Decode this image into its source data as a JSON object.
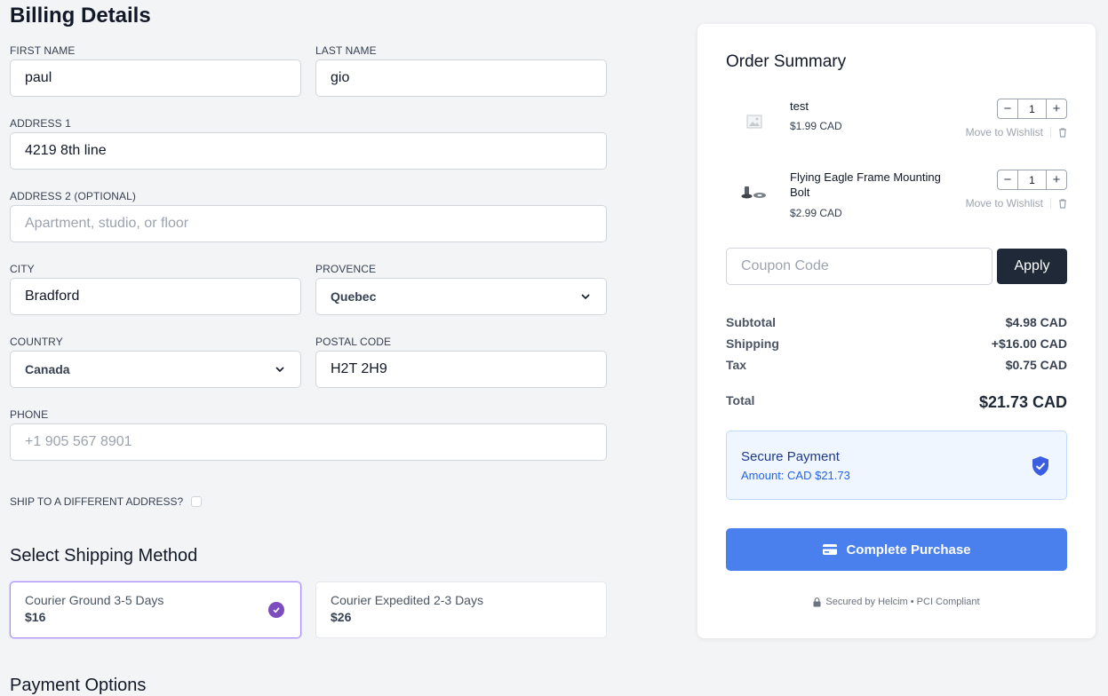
{
  "billing": {
    "title": "Billing Details",
    "first_name": {
      "label": "FIRST NAME",
      "value": "paul"
    },
    "last_name": {
      "label": "LAST NAME",
      "value": "gio"
    },
    "address1": {
      "label": "ADDRESS 1",
      "value": "4219 8th line"
    },
    "address2": {
      "label": "ADDRESS 2 (OPTIONAL)",
      "placeholder": "Apartment, studio, or floor"
    },
    "city": {
      "label": "CITY",
      "value": "Bradford"
    },
    "province": {
      "label": "PROVENCE",
      "value": "Quebec"
    },
    "country": {
      "label": "COUNTRY",
      "value": "Canada"
    },
    "postal": {
      "label": "POSTAL CODE",
      "value": "H2T 2H9"
    },
    "phone": {
      "label": "PHONE",
      "placeholder": "+1 905 567 8901"
    },
    "ship_different": "SHIP TO A DIFFERENT ADDRESS?"
  },
  "shipping": {
    "title": "Select Shipping Method",
    "options": [
      {
        "name": "Courier Ground 3-5 Days",
        "price": "$16",
        "selected": true
      },
      {
        "name": "Courier Expedited 2-3 Days",
        "price": "$26",
        "selected": false
      }
    ]
  },
  "payment_options_title": "Payment Options",
  "summary": {
    "title": "Order Summary",
    "items": [
      {
        "name": "test",
        "price": "$1.99 CAD",
        "qty": "1",
        "wishlist": "Move to Wishlist"
      },
      {
        "name": "Flying Eagle Frame Mounting Bolt",
        "price": "$2.99 CAD",
        "qty": "1",
        "wishlist": "Move to Wishlist"
      }
    ],
    "coupon_placeholder": "Coupon Code",
    "apply_label": "Apply",
    "subtotal": {
      "label": "Subtotal",
      "value": "$4.98 CAD"
    },
    "shipping": {
      "label": "Shipping",
      "value": "+$16.00 CAD"
    },
    "tax": {
      "label": "Tax",
      "value": "$0.75 CAD"
    },
    "total": {
      "label": "Total",
      "value": "$21.73 CAD"
    },
    "secure_title": "Secure Payment",
    "secure_amount": "Amount: CAD $21.73",
    "purchase_label": "Complete Purchase",
    "footer": "Secured by Helcim • PCI Compliant"
  },
  "colors": {
    "accent": "#4a7fee",
    "selected": "#7c4dbd",
    "dark_button": "#1f2937"
  }
}
